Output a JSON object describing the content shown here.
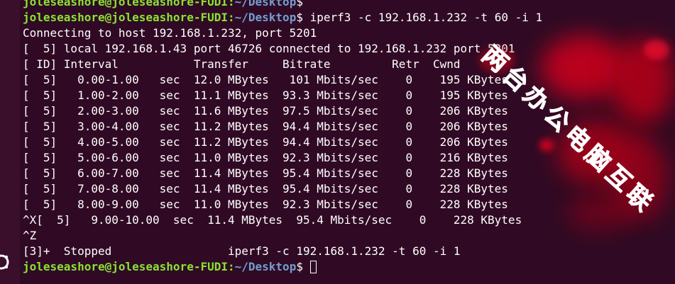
{
  "prompt": {
    "user": "joleseashore@joleseashore-FUDI",
    "sep": ":",
    "path": "~/Desktop",
    "symbol": "$"
  },
  "lines": [
    {
      "type": "prompt",
      "cmd": ""
    },
    {
      "type": "prompt",
      "cmd": " iperf3 -c 192.168.1.232 -t 60 -i 1"
    },
    {
      "type": "text",
      "text": "Connecting to host 192.168.1.232, port 5201"
    },
    {
      "type": "text",
      "text": "[  5] local 192.168.1.43 port 46726 connected to 192.168.1.232 port 5201"
    },
    {
      "type": "text",
      "text": "[ ID] Interval           Transfer     Bitrate         Retr  Cwnd"
    },
    {
      "type": "text",
      "text": "[  5]   0.00-1.00   sec  12.0 MBytes   101 Mbits/sec    0    195 KBytes"
    },
    {
      "type": "text",
      "text": "[  5]   1.00-2.00   sec  11.1 MBytes  93.3 Mbits/sec    0    195 KBytes"
    },
    {
      "type": "text",
      "text": "[  5]   2.00-3.00   sec  11.6 MBytes  97.5 Mbits/sec    0    206 KBytes"
    },
    {
      "type": "text",
      "text": "[  5]   3.00-4.00   sec  11.2 MBytes  94.4 Mbits/sec    0    206 KBytes"
    },
    {
      "type": "text",
      "text": "[  5]   4.00-5.00   sec  11.2 MBytes  94.4 Mbits/sec    0    206 KBytes"
    },
    {
      "type": "text",
      "text": "[  5]   5.00-6.00   sec  11.0 MBytes  92.3 Mbits/sec    0    216 KBytes"
    },
    {
      "type": "text",
      "text": "[  5]   6.00-7.00   sec  11.4 MBytes  95.4 Mbits/sec    0    228 KBytes"
    },
    {
      "type": "text",
      "text": "[  5]   7.00-8.00   sec  11.4 MBytes  95.4 Mbits/sec    0    228 KBytes"
    },
    {
      "type": "text",
      "text": "[  5]   8.00-9.00   sec  11.0 MBytes  92.3 Mbits/sec    0    228 KBytes"
    },
    {
      "type": "text",
      "text": "^X[  5]   9.00-10.00  sec  11.4 MBytes  95.4 Mbits/sec    0    228 KBytes"
    },
    {
      "type": "text",
      "text": "^Z"
    },
    {
      "type": "text",
      "text": "[3]+  Stopped                 iperf3 -c 192.168.1.232 -t 60 -i 1"
    },
    {
      "type": "prompt",
      "cmd": " ",
      "cursor": true
    }
  ],
  "watermark": {
    "text": "两台办公电脑互联",
    "color": "#ffffff"
  },
  "colors": {
    "background": "#300a24",
    "user": "#8ae234",
    "path": "#729fcf",
    "text": "#ffffff",
    "splash": "#e00018"
  },
  "icons": {
    "left_edge": "ubuntu-logo-icon"
  }
}
